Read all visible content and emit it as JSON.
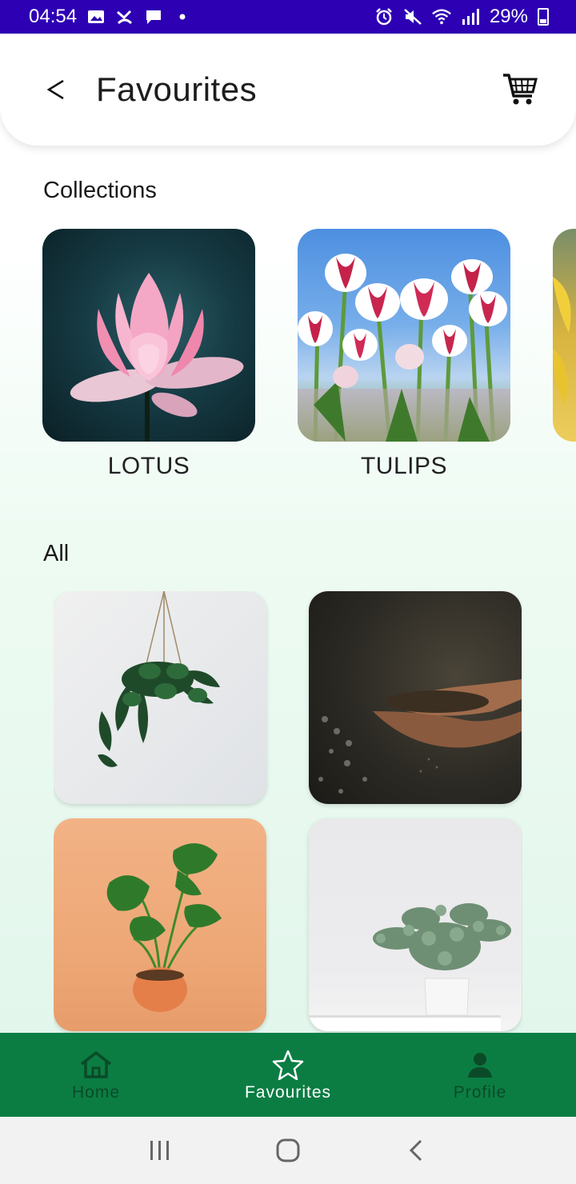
{
  "status_bar": {
    "time": "04:54",
    "battery": "29%",
    "left_icons": [
      "image-icon",
      "missed-call-icon",
      "message-icon",
      "dot-icon"
    ],
    "right_icons": [
      "alarm-icon",
      "mute-icon",
      "wifi-icon",
      "signal-icon",
      "battery-icon"
    ]
  },
  "header": {
    "title": "Favourites",
    "back_icon": "chevron-left-icon",
    "cart_icon": "cart-icon"
  },
  "collections": {
    "title": "Collections",
    "items": [
      {
        "label": "LOTUS",
        "image": "lotus-flower"
      },
      {
        "label": "TULIPS",
        "image": "tulips-field"
      },
      {
        "label": "",
        "image": "yellow-flower-partial"
      }
    ]
  },
  "all": {
    "title": "All",
    "items": [
      {
        "image": "hanging-pothos-plant"
      },
      {
        "image": "hands-holding-soil"
      },
      {
        "image": "monstera-in-orange-pot"
      },
      {
        "image": "eucalyptus-in-white-pot"
      }
    ]
  },
  "bottom_nav": {
    "active": "Favourites",
    "items": [
      {
        "label": "Home",
        "icon": "home-icon"
      },
      {
        "label": "Favourites",
        "icon": "star-icon"
      },
      {
        "label": "Profile",
        "icon": "person-icon"
      }
    ]
  },
  "colors": {
    "status_bar": "#2d00b4",
    "nav_bar": "#0b7d43",
    "nav_inactive": "#0a4a28",
    "nav_active": "#ffffff"
  }
}
